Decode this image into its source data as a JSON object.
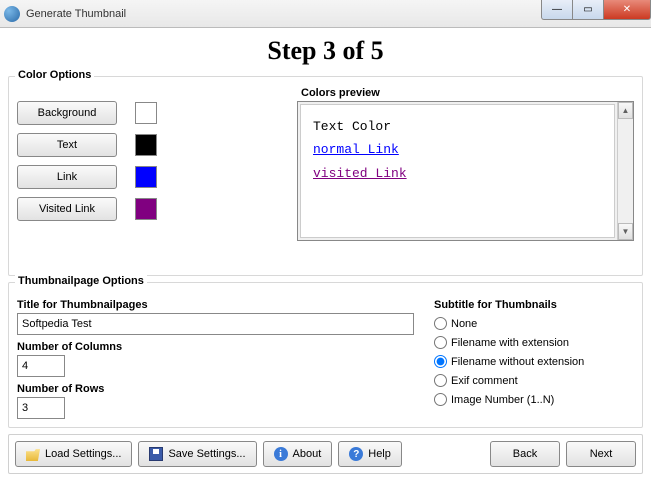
{
  "window": {
    "title": "Generate Thumbnail"
  },
  "step_title": "Step 3 of 5",
  "color_options": {
    "legend": "Color Options",
    "rows": [
      {
        "label": "Background",
        "color": "#ffffff"
      },
      {
        "label": "Text",
        "color": "#000000"
      },
      {
        "label": "Link",
        "color": "#0000ff"
      },
      {
        "label": "Visited Link",
        "color": "#800080"
      }
    ],
    "preview": {
      "label": "Colors preview",
      "text_line": "Text Color",
      "normal_link": "normal Link",
      "visited_link": "visited Link"
    }
  },
  "thumb_options": {
    "legend": "Thumbnailpage Options",
    "title_label": "Title for Thumbnailpages",
    "title_value": "Softpedia Test",
    "cols_label": "Number of Columns",
    "cols_value": "4",
    "rows_label": "Number of Rows",
    "rows_value": "3",
    "subtitle_label": "Subtitle for Thumbnails",
    "radios": {
      "none": "None",
      "with_ext": "Filename with extension",
      "without_ext": "Filename without extension",
      "exif": "Exif comment",
      "imgnum": "Image Number (1..N)"
    },
    "selected": "without_ext"
  },
  "bottom": {
    "load": "Load Settings...",
    "save": "Save Settings...",
    "about": "About",
    "help": "Help",
    "back": "Back",
    "next": "Next"
  }
}
